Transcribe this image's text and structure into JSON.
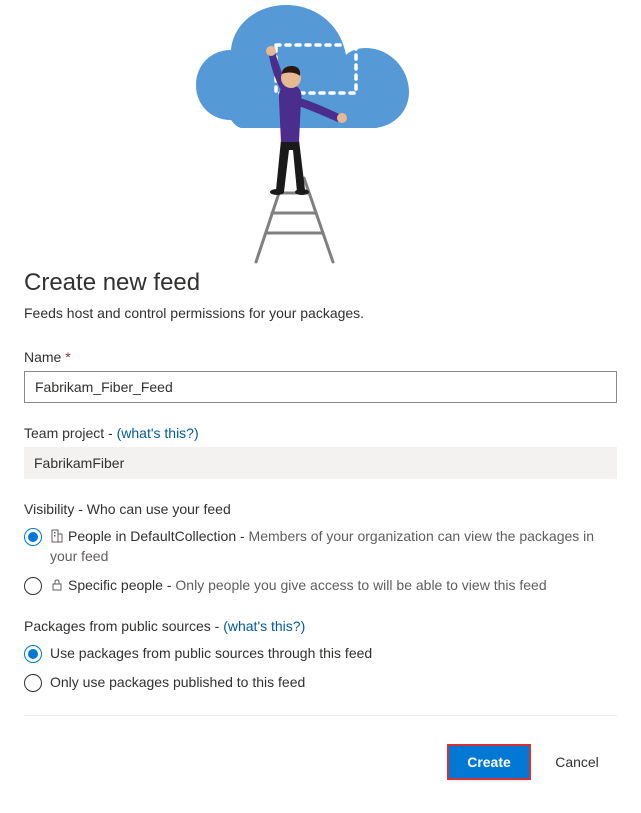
{
  "header": {
    "title": "Create new feed",
    "subtitle": "Feeds host and control permissions for your packages."
  },
  "name_field": {
    "label": "Name",
    "required_mark": "*",
    "value": "Fabrikam_Fiber_Feed"
  },
  "project_field": {
    "label": "Team project - ",
    "help_link": "(what's this?)",
    "value": "FabrikamFiber"
  },
  "visibility": {
    "label": "Visibility - Who can use your feed",
    "options": [
      {
        "title": "People in DefaultCollection - ",
        "desc": "Members of your organization can view the packages in your feed"
      },
      {
        "title": "Specific people - ",
        "desc": "Only people you give access to will be able to view this feed"
      }
    ]
  },
  "upstream": {
    "label_prefix": "Packages from public sources - ",
    "help_link": "(what's this?)",
    "options": [
      {
        "label": "Use packages from public sources through this feed"
      },
      {
        "label": "Only use packages published to this feed"
      }
    ]
  },
  "buttons": {
    "create": "Create",
    "cancel": "Cancel"
  }
}
